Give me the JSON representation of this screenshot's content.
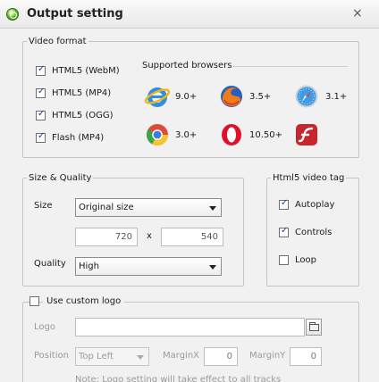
{
  "window": {
    "title": "Output setting",
    "close_glyph": "×"
  },
  "video_format": {
    "legend": "Video format",
    "formats": [
      {
        "label": "HTML5 (WebM)",
        "checked": true
      },
      {
        "label": "HTML5 (MP4)",
        "checked": true
      },
      {
        "label": "HTML5 (OGG)",
        "checked": true
      },
      {
        "label": "Flash (MP4)",
        "checked": true
      }
    ],
    "supported_title": "Supported browsers",
    "browsers": [
      {
        "icon": "ie-icon",
        "version": "9.0+"
      },
      {
        "icon": "firefox-icon",
        "version": "3.5+"
      },
      {
        "icon": "safari-icon",
        "version": "3.1+"
      },
      {
        "icon": "chrome-icon",
        "version": "3.0+"
      },
      {
        "icon": "opera-icon",
        "version": "10.50+"
      },
      {
        "icon": "flash-icon",
        "version": ""
      }
    ]
  },
  "size_quality": {
    "legend": "Size & Quality",
    "size_label": "Size",
    "size_value": "Original size",
    "width": "720",
    "x_sep": "x",
    "height": "540",
    "quality_label": "Quality",
    "quality_value": "High"
  },
  "html5_tag": {
    "legend": "Html5 video tag",
    "options": [
      {
        "label": "Autoplay",
        "checked": true
      },
      {
        "label": "Controls",
        "checked": true
      },
      {
        "label": "Loop",
        "checked": false
      }
    ]
  },
  "custom_logo": {
    "label": "Use custom logo",
    "checked": false,
    "logo_label": "Logo",
    "logo_value": "",
    "position_label": "Position",
    "position_value": "Top Left",
    "marginx_label": "MarginX",
    "marginx_value": "0",
    "marginy_label": "MarginY",
    "marginy_value": "0",
    "note": "Note: Logo setting will take effect to all tracks"
  },
  "colors": {
    "accent": "#1c3f8f",
    "disabled_text": "#9a9a9a",
    "border": "#c4c4c4"
  }
}
